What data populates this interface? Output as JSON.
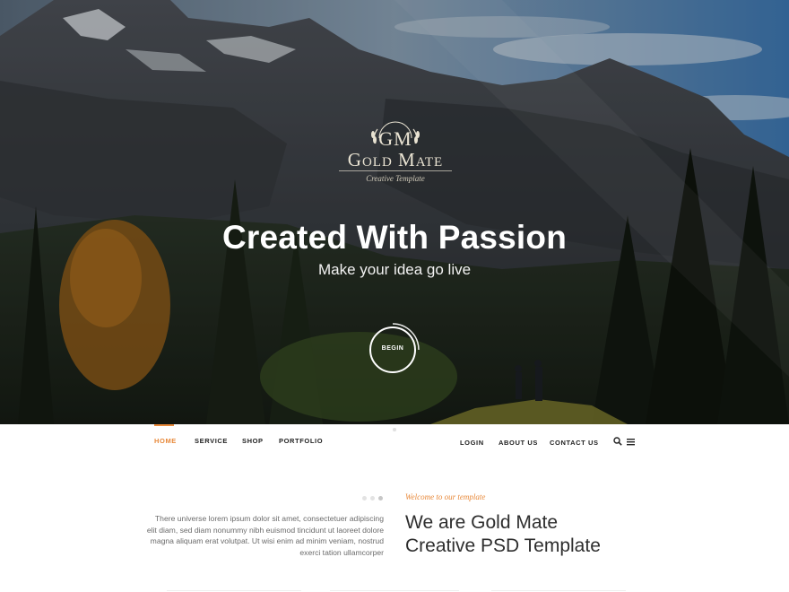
{
  "hero": {
    "logo_monogram": "GM",
    "logo_brand": "Gold Mate",
    "logo_tagline": "Creative Template",
    "title": "Created With Passion",
    "subtitle": "Make your idea go live",
    "begin_label": "BEGIN"
  },
  "nav": {
    "left_items": [
      {
        "label": "HOME",
        "active": true
      },
      {
        "label": "SERVICE",
        "active": false
      },
      {
        "label": "SHOP",
        "active": false
      },
      {
        "label": "PORTFOLIO",
        "active": false
      }
    ],
    "right_items": [
      {
        "label": "LOGIN"
      },
      {
        "label": "ABOUT US"
      },
      {
        "label": "CONTACT US"
      }
    ],
    "icons": [
      "search-icon",
      "menu-icon"
    ]
  },
  "content": {
    "intro_text": "There universe lorem ipsum dolor sit amet, consectetuer adipiscing elit diam, sed diam nonummy nibh euismod tincidunt ut laoreet dolore magna aliquam erat volutpat. Ut wisi enim ad minim veniam, nostrud exerci tation ullamcorper",
    "eyebrow": "Welcome to our template",
    "heading_line1": "We are Gold Mate",
    "heading_line2": "Creative PSD Template",
    "slider_dots": 3,
    "active_dot": 3
  },
  "colors": {
    "accent": "#e8893a",
    "text_dark": "#2e2e2e",
    "text_muted": "#6b6b6b"
  }
}
